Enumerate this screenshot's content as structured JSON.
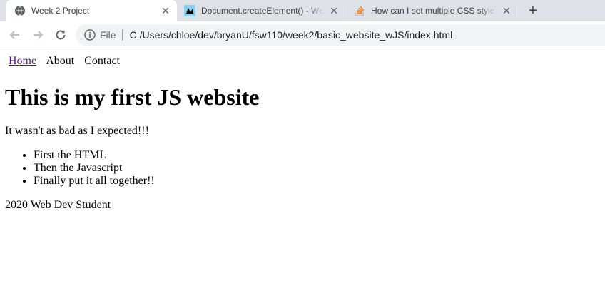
{
  "browser": {
    "tabs": [
      {
        "title": "Week 2 Project",
        "icon": "globe-icon",
        "active": true
      },
      {
        "title": "Document.createElement() - Web",
        "icon": "mdn-icon",
        "active": false
      },
      {
        "title": "How can I set multiple CSS styles",
        "icon": "stackoverflow-icon",
        "active": false
      }
    ],
    "new_tab_label": "+",
    "close_glyph": "✕",
    "address": {
      "scheme_label": "File",
      "url": "C:/Users/chloe/dev/bryanU/fsw110/week2/basic_website_wJS/index.html"
    }
  },
  "page": {
    "nav": {
      "home": "Home",
      "about": "About",
      "contact": "Contact"
    },
    "heading": "This is my first JS website",
    "intro": "It wasn't as bad as I expected!!!",
    "list": [
      "First the HTML",
      "Then the Javascript",
      "Finally put it all together!!"
    ],
    "footer": "2020 Web Dev Student"
  },
  "colors": {
    "tabstrip_bg": "#dee1e6",
    "omnibox_bg": "#f1f3f4",
    "visited_link": "#551a8b"
  }
}
